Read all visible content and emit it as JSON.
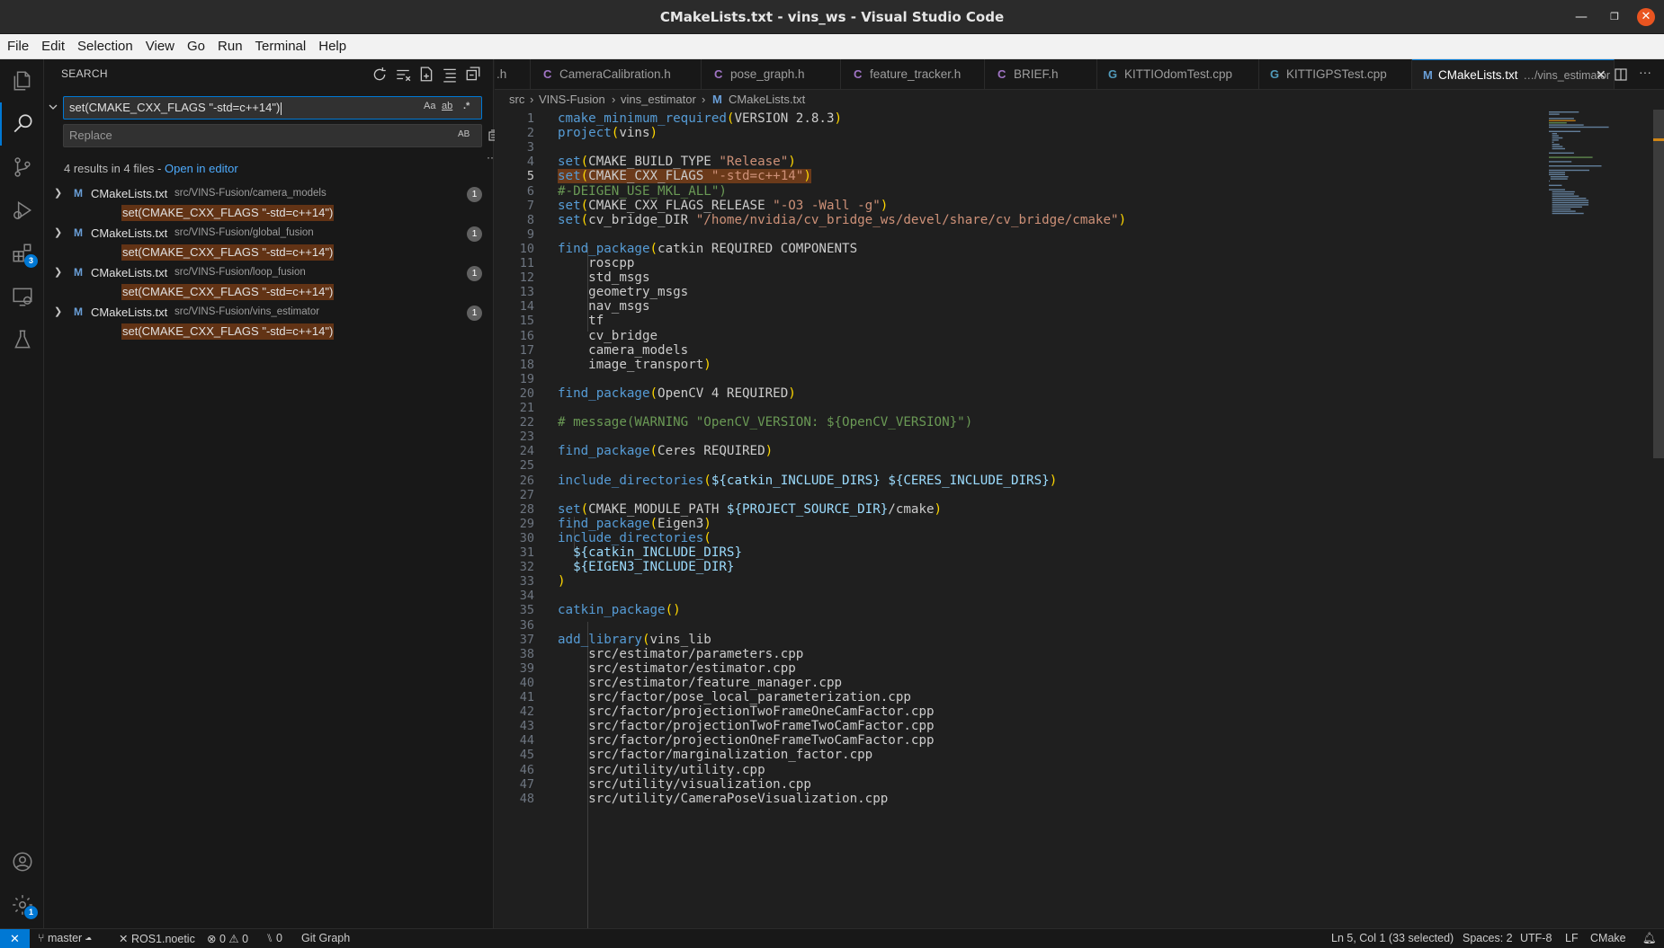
{
  "window": {
    "title": "CMakeLists.txt - vins_ws - Visual Studio Code"
  },
  "menu": [
    "File",
    "Edit",
    "Selection",
    "View",
    "Go",
    "Run",
    "Terminal",
    "Help"
  ],
  "activity_bar": {
    "extensions_badge": "3",
    "settings_badge": "1"
  },
  "search": {
    "header": "SEARCH",
    "query": "set(CMAKE_CXX_FLAGS \"-std=c++14\")",
    "match_case": "Aa",
    "whole_word": "ab",
    "regex": ".*",
    "replace_placeholder": "Replace",
    "preserve_case": "AB",
    "summary_text": "4 results in 4 files - ",
    "open_in_editor": "Open in editor",
    "results": [
      {
        "file": "CMakeLists.txt",
        "path": "src/VINS-Fusion/camera_models",
        "count": "1",
        "match": "set(CMAKE_CXX_FLAGS \"-std=c++14\")"
      },
      {
        "file": "CMakeLists.txt",
        "path": "src/VINS-Fusion/global_fusion",
        "count": "1",
        "match": "set(CMAKE_CXX_FLAGS \"-std=c++14\")"
      },
      {
        "file": "CMakeLists.txt",
        "path": "src/VINS-Fusion/loop_fusion",
        "count": "1",
        "match": "set(CMAKE_CXX_FLAGS \"-std=c++14\")"
      },
      {
        "file": "CMakeLists.txt",
        "path": "src/VINS-Fusion/vins_estimator",
        "count": "1",
        "match": "set(CMAKE_CXX_FLAGS \"-std=c++14\")"
      }
    ]
  },
  "tabs": [
    {
      "icon": "",
      "label": ".h"
    },
    {
      "icon": "C",
      "label": "CameraCalibration.h"
    },
    {
      "icon": "C",
      "label": "pose_graph.h"
    },
    {
      "icon": "C",
      "label": "feature_tracker.h"
    },
    {
      "icon": "C",
      "label": "BRIEF.h"
    },
    {
      "icon": "G",
      "label": "KITTIOdomTest.cpp"
    },
    {
      "icon": "G",
      "label": "KITTIGPSTest.cpp"
    },
    {
      "icon": "M",
      "label": "CMakeLists.txt",
      "sub": "…/vins_estimator"
    }
  ],
  "breadcrumb": [
    "src",
    "VINS-Fusion",
    "vins_estimator",
    "CMakeLists.txt"
  ],
  "editor": {
    "current_line": 5,
    "lines": [
      "cmake_minimum_required(VERSION 2.8.3)",
      "project(vins)",
      "",
      "set(CMAKE_BUILD_TYPE \"Release\")",
      "set(CMAKE_CXX_FLAGS \"-std=c++14\")",
      "#-DEIGEN_USE_MKL_ALL\")",
      "set(CMAKE_CXX_FLAGS_RELEASE \"-O3 -Wall -g\")",
      "set(cv_bridge_DIR \"/home/nvidia/cv_bridge_ws/devel/share/cv_bridge/cmake\")",
      "",
      "find_package(catkin REQUIRED COMPONENTS",
      "    roscpp",
      "    std_msgs",
      "    geometry_msgs",
      "    nav_msgs",
      "    tf",
      "    cv_bridge",
      "    camera_models",
      "    image_transport)",
      "",
      "find_package(OpenCV 4 REQUIRED)",
      "",
      "# message(WARNING \"OpenCV_VERSION: ${OpenCV_VERSION}\")",
      "",
      "find_package(Ceres REQUIRED)",
      "",
      "include_directories(${catkin_INCLUDE_DIRS} ${CERES_INCLUDE_DIRS})",
      "",
      "set(CMAKE_MODULE_PATH ${PROJECT_SOURCE_DIR}/cmake)",
      "find_package(Eigen3)",
      "include_directories(",
      "  ${catkin_INCLUDE_DIRS}",
      "  ${EIGEN3_INCLUDE_DIR}",
      ")",
      "",
      "catkin_package()",
      "",
      "add_library(vins_lib",
      "    src/estimator/parameters.cpp",
      "    src/estimator/estimator.cpp",
      "    src/estimator/feature_manager.cpp",
      "    src/factor/pose_local_parameterization.cpp",
      "    src/factor/projectionTwoFrameOneCamFactor.cpp",
      "    src/factor/projectionTwoFrameTwoCamFactor.cpp",
      "    src/factor/projectionOneFrameTwoCamFactor.cpp",
      "    src/factor/marginalization_factor.cpp",
      "    src/utility/utility.cpp",
      "    src/utility/visualization.cpp",
      "    src/utility/CameraPoseVisualization.cpp"
    ]
  },
  "status": {
    "branch": "master",
    "ros": "ROS1.noetic",
    "errors": "0",
    "warnings": "0",
    "ports": "0",
    "git_graph": "Git Graph",
    "cursor": "Ln 5, Col 1 (33 selected)",
    "spaces": "Spaces: 2",
    "encoding": "UTF-8",
    "eol": "LF",
    "language": "CMake"
  }
}
